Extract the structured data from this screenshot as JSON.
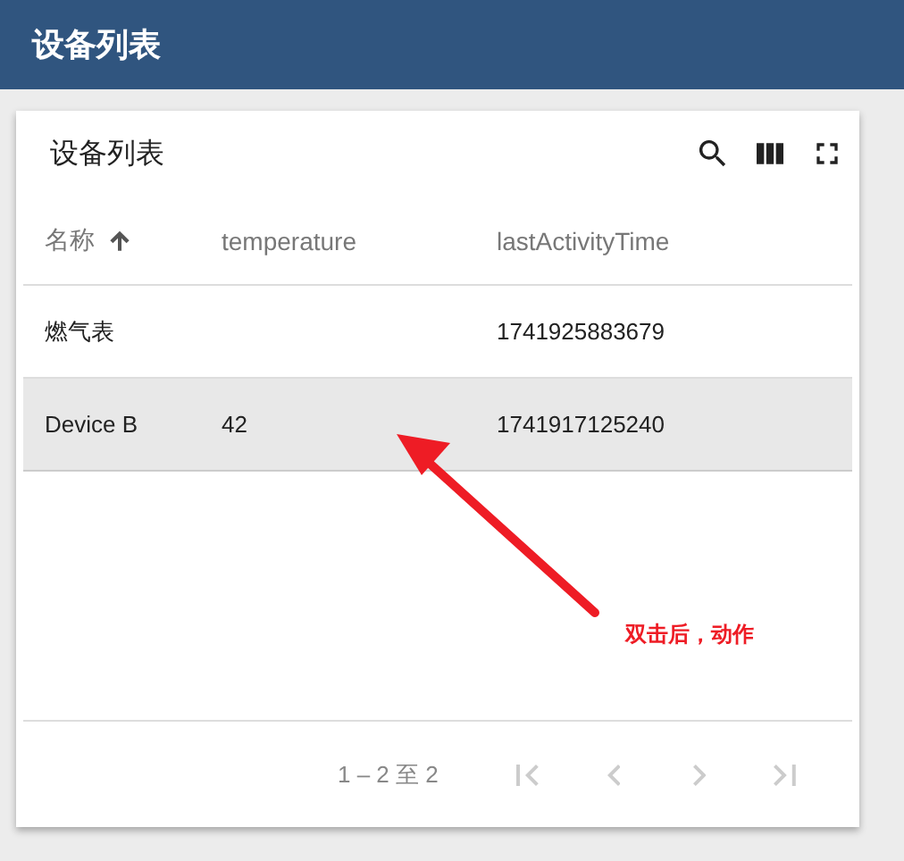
{
  "app_bar": {
    "title": "设备列表"
  },
  "card": {
    "title": "设备列表"
  },
  "table": {
    "columns": [
      {
        "label": "名称",
        "sorted": true
      },
      {
        "label": "temperature",
        "sorted": false
      },
      {
        "label": "lastActivityTime",
        "sorted": false
      }
    ],
    "rows": [
      {
        "cells": [
          "燃气表",
          "",
          "1741925883679"
        ],
        "selected": false
      },
      {
        "cells": [
          "Device B",
          "42",
          "1741917125240"
        ],
        "selected": true
      }
    ]
  },
  "pagination": {
    "range": "1 – 2 至 2",
    "buttons": [
      {
        "kind": "first",
        "disabled": true
      },
      {
        "kind": "prev",
        "disabled": true
      },
      {
        "kind": "next",
        "disabled": true
      },
      {
        "kind": "last",
        "disabled": true
      }
    ]
  },
  "annotation": {
    "text": "双击后，动作"
  }
}
